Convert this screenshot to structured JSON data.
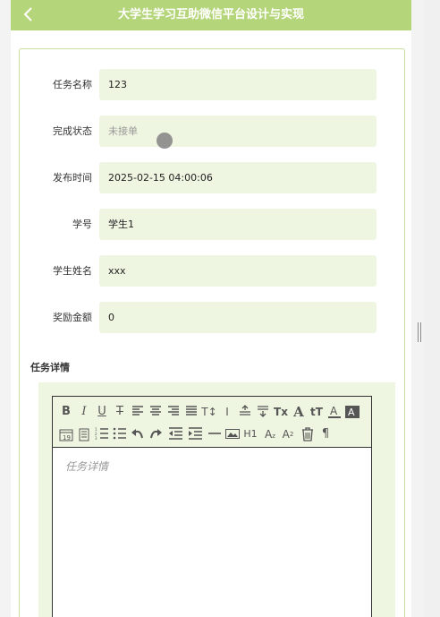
{
  "header": {
    "title": "大学生学习互助微信平台设计与实现"
  },
  "form": [
    {
      "label": "任务名称",
      "value": "123"
    },
    {
      "label": "完成状态",
      "value": "未接单"
    },
    {
      "label": "发布时间",
      "value": "2025-02-15 04:00:06"
    },
    {
      "label": "学号",
      "value": "学生1"
    },
    {
      "label": "学生姓名",
      "value": "xxx"
    },
    {
      "label": "奖励金额",
      "value": "0"
    }
  ],
  "detail": {
    "label": "任务详情",
    "placeholder": "任务详情"
  },
  "colors": {
    "header": "#b5d57a",
    "field_bg": "#eef6e1",
    "card_border": "#c8df9c"
  },
  "toolbar_icons": [
    "bold-icon",
    "italic-icon",
    "underline-icon",
    "strikethrough-icon",
    "align-left-icon",
    "align-center-icon",
    "align-right-icon",
    "justify-icon",
    "font-size-icon",
    "line-height-icon",
    "paragraph-spacing-top-icon",
    "paragraph-spacing-bottom-icon",
    "clear-format-icon",
    "font-family-icon",
    "font-style-icon",
    "font-color-icon",
    "background-color-icon",
    "date-icon",
    "time-icon",
    "ordered-list-icon",
    "unordered-list-icon",
    "undo-icon",
    "redo-icon",
    "outdent-icon",
    "indent-icon",
    "horizontal-rule-icon",
    "image-icon",
    "heading-icon",
    "subscript-icon",
    "superscript-icon",
    "delete-icon",
    "paragraph-mark-icon"
  ]
}
